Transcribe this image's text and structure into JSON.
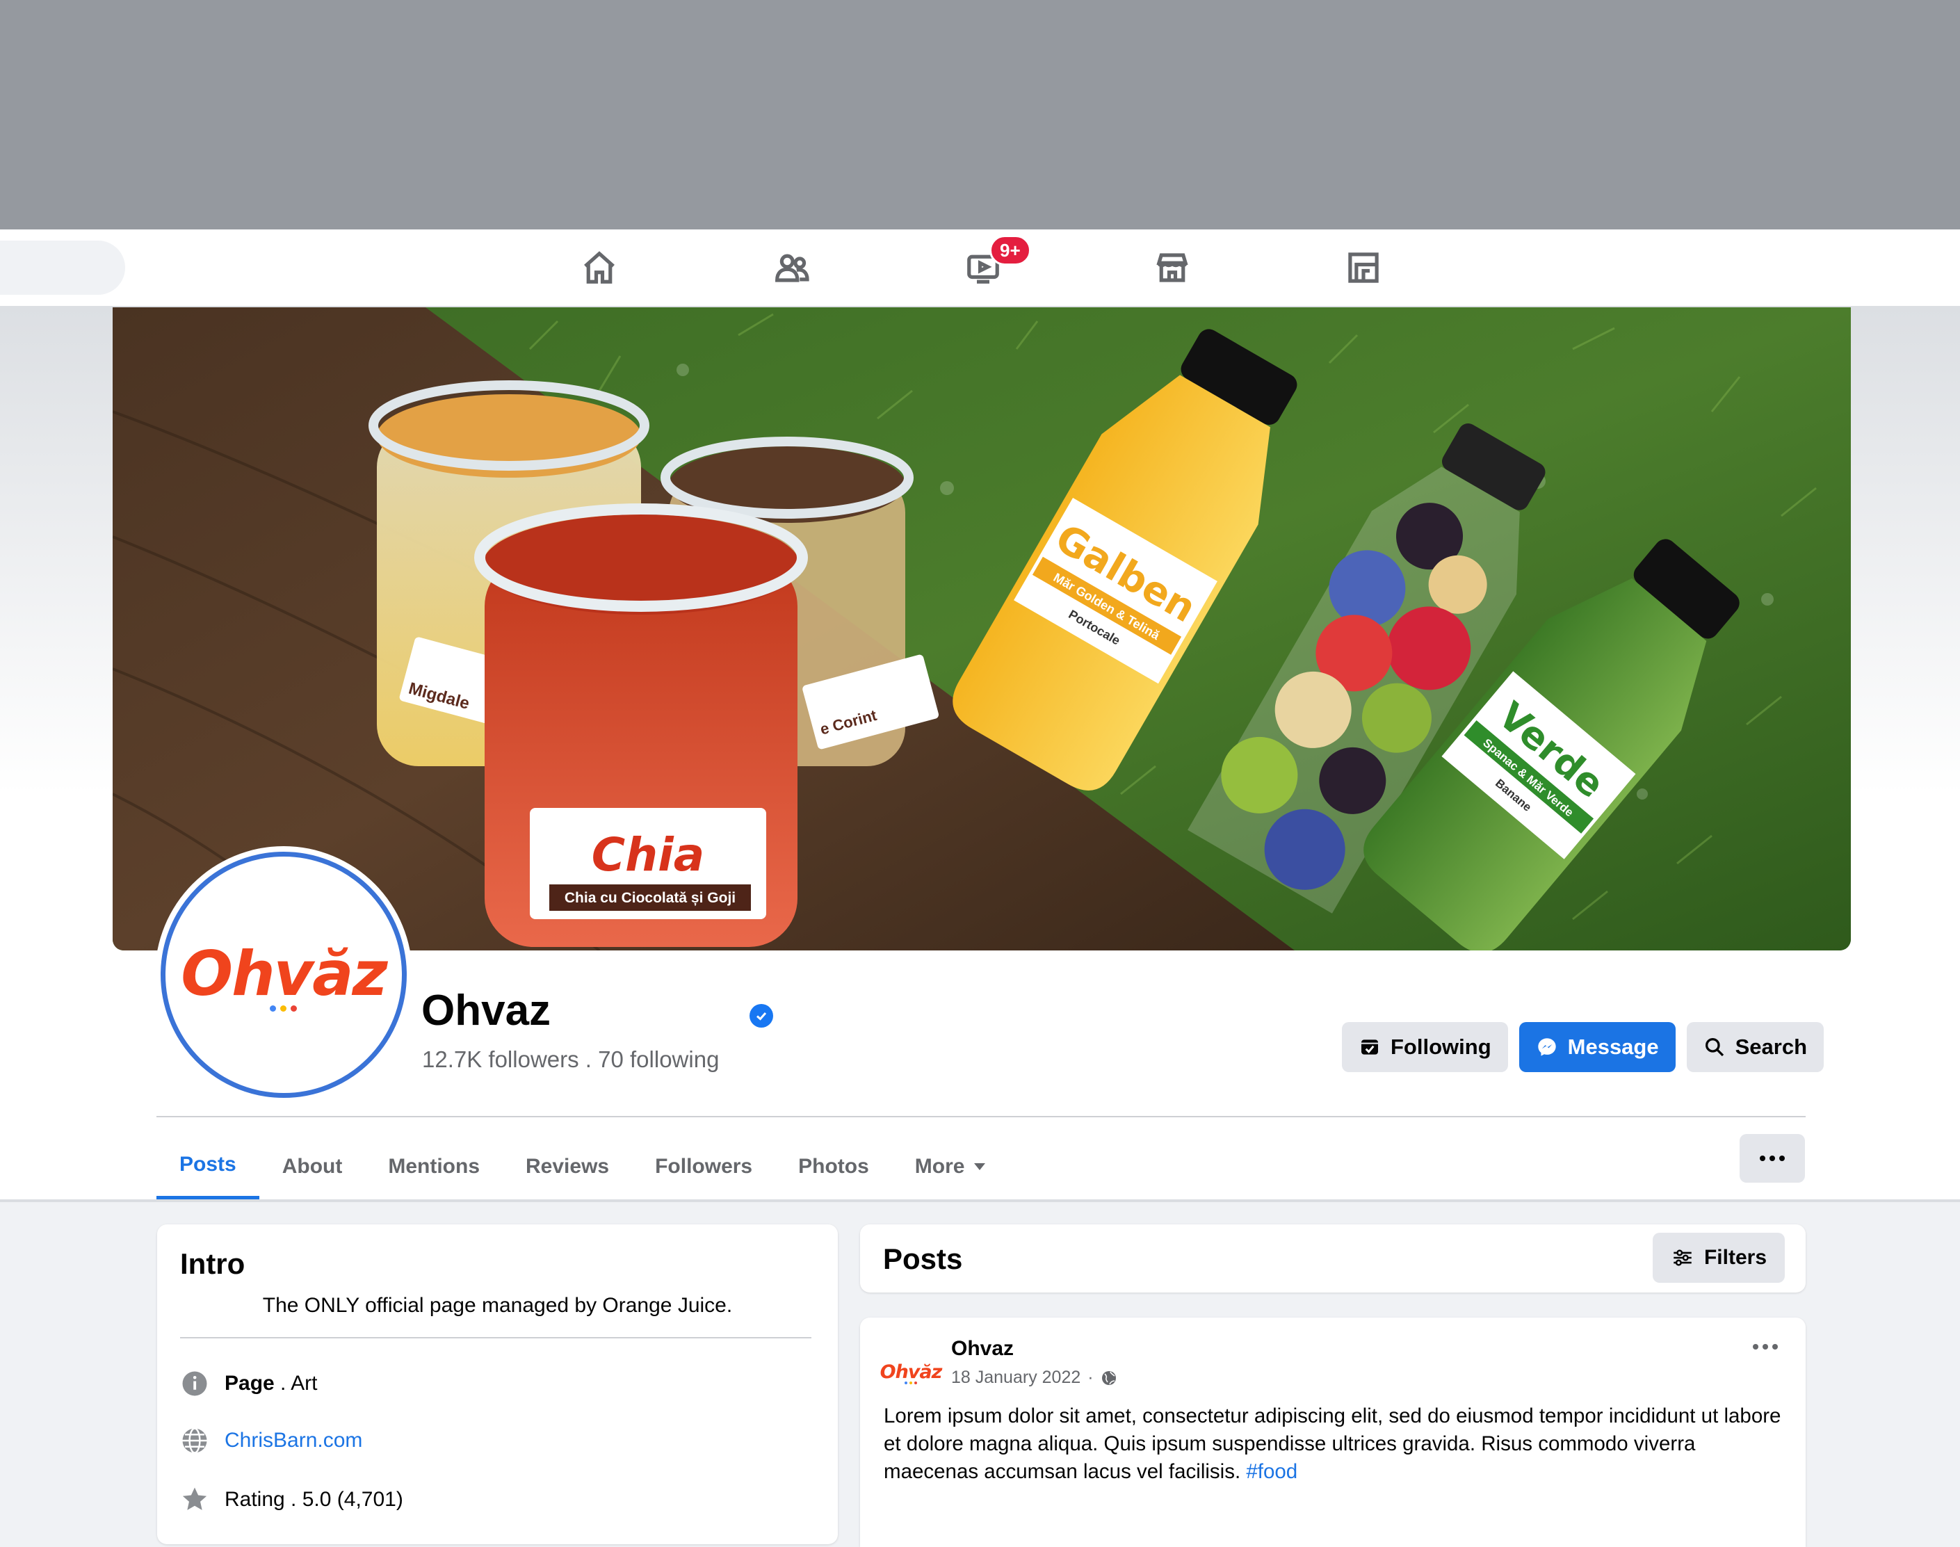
{
  "nav": {
    "watch_badge": "9+"
  },
  "page": {
    "name": "Ohvaz",
    "followers": "12.7K followers",
    "separator": " . ",
    "following": "70 following",
    "logo_text": "Ohvăz"
  },
  "actions": {
    "following": "Following",
    "message": "Message",
    "search": "Search"
  },
  "tabs": [
    {
      "label": "Posts"
    },
    {
      "label": "About"
    },
    {
      "label": "Mentions"
    },
    {
      "label": "Reviews"
    },
    {
      "label": "Followers"
    },
    {
      "label": "Photos"
    },
    {
      "label": "More"
    }
  ],
  "intro": {
    "title": "Intro",
    "bio": "The ONLY official page managed by Orange Juice.",
    "category_label": "Page",
    "category_value": " . Art",
    "website": "ChrisBarn.com",
    "rating": "Rating . 5.0 (4,701)"
  },
  "posts": {
    "title": "Posts",
    "filters": "Filters",
    "items": [
      {
        "author": "Ohvaz",
        "logo_text": "Ohvăz",
        "date": "18 January 2022",
        "dot": "·",
        "text": "Lorem ipsum dolor sit amet, consectetur adipiscing elit, sed do eiusmod tempor incididunt ut labore et dolore magna aliqua. Quis ipsum suspendisse ultrices gravida. Risus commodo viverra maecenas accumsan lacus vel facilisis.",
        "hashtag": "#food"
      }
    ]
  },
  "cover": {
    "jar_label_main": "Chia",
    "jar_label_sub": "Chia cu Ciocolată și Goji",
    "jar_left_sub": "Migdale",
    "jar_right_sub": "e Corint",
    "bottle_yellow_name": "Galben",
    "bottle_yellow_sub": "Măr Golden & Telină",
    "bottle_yellow_sub2": "Portocale",
    "bottle_green_name": "Verde",
    "bottle_green_sub": "Spanac & Măr Verde",
    "bottle_green_sub2": "Banane"
  },
  "colors": {
    "brand_orange": "#f0441d",
    "accent_blue": "#1b74e4",
    "badge_red": "#e41e3f"
  }
}
